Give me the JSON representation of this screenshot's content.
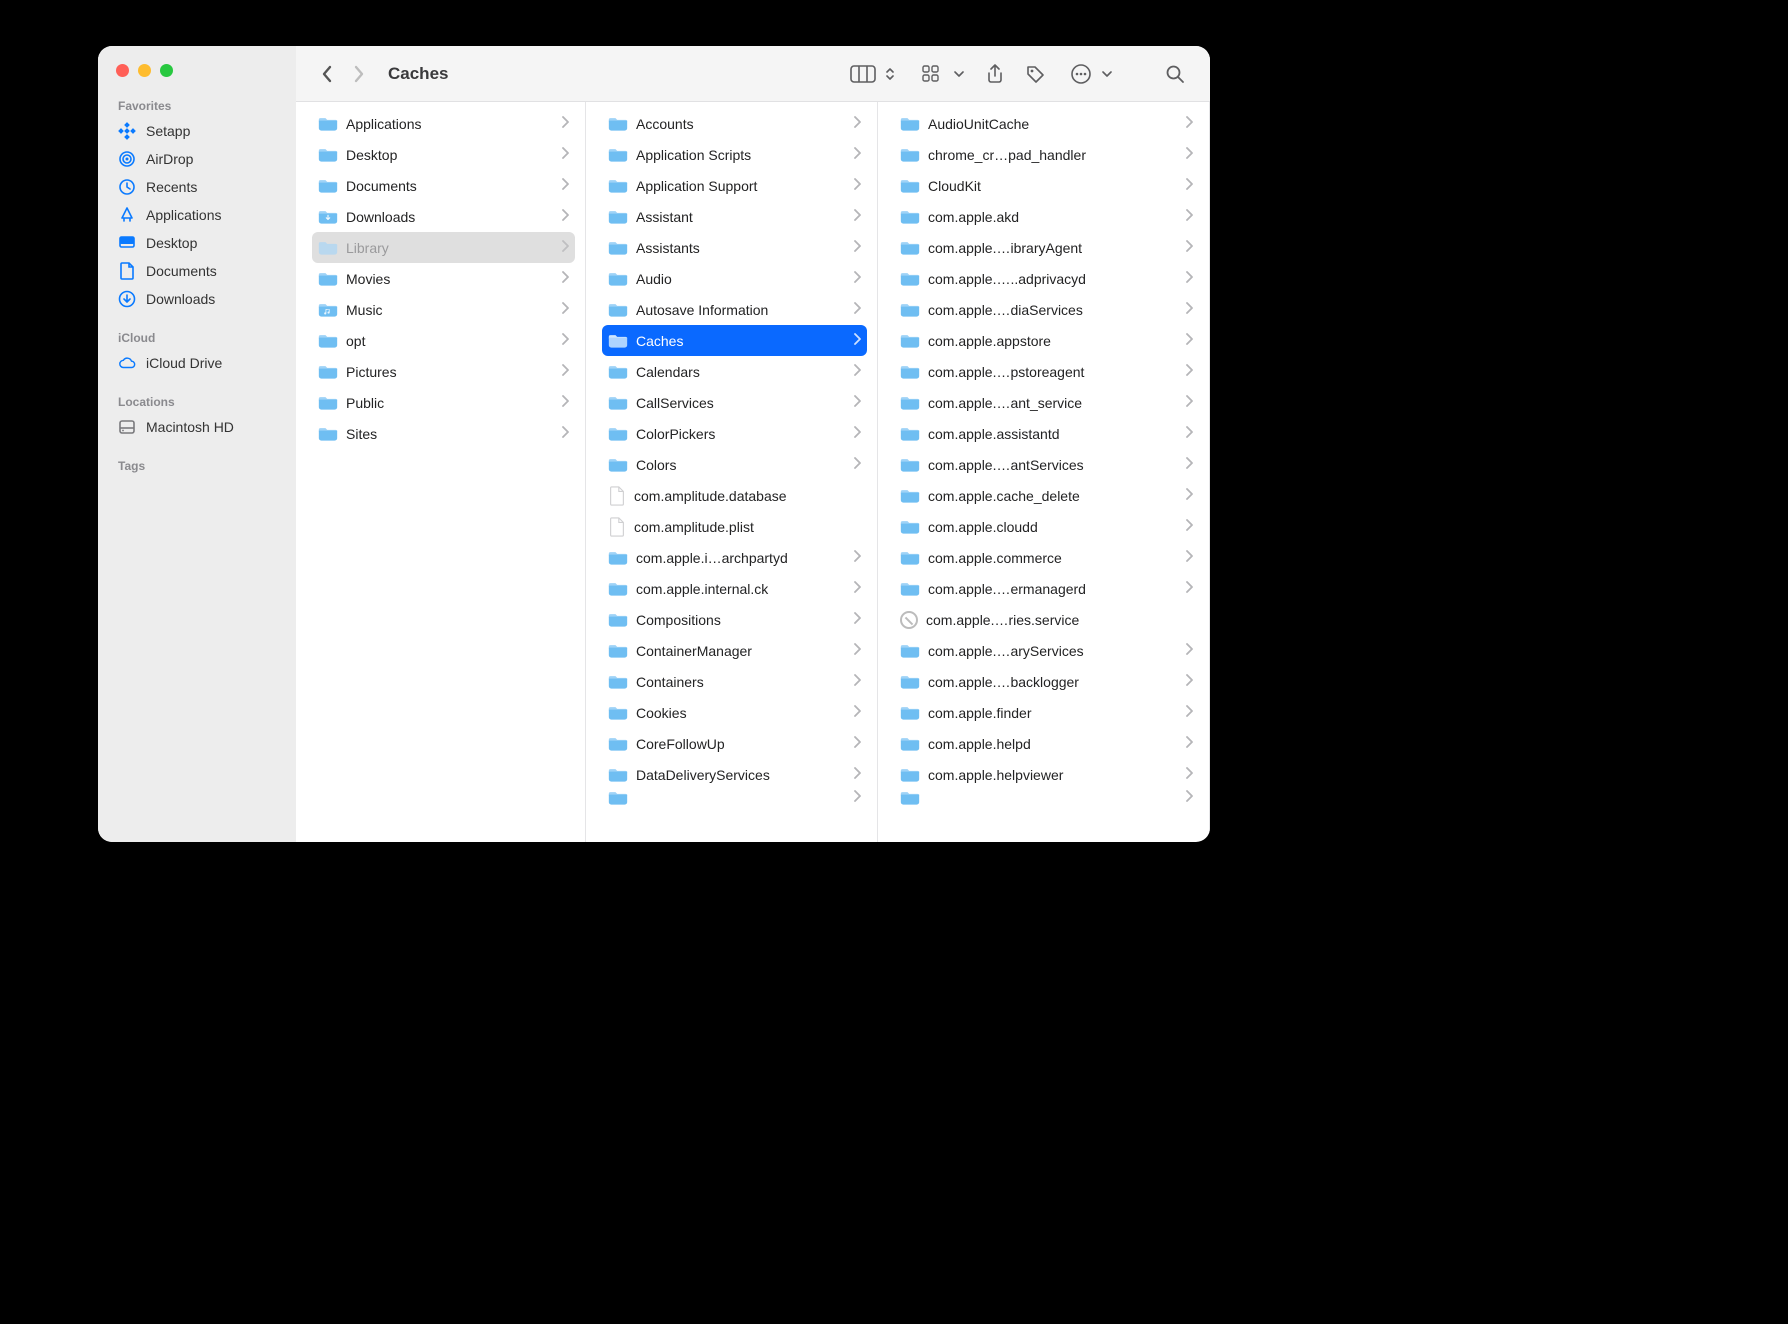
{
  "window_title": "Caches",
  "sidebar": {
    "sections": [
      {
        "title": "Favorites",
        "items": [
          {
            "icon": "setapp",
            "label": "Setapp"
          },
          {
            "icon": "airdrop",
            "label": "AirDrop"
          },
          {
            "icon": "recents",
            "label": "Recents"
          },
          {
            "icon": "applications",
            "label": "Applications"
          },
          {
            "icon": "desktop",
            "label": "Desktop"
          },
          {
            "icon": "documents",
            "label": "Documents"
          },
          {
            "icon": "downloads",
            "label": "Downloads"
          }
        ]
      },
      {
        "title": "iCloud",
        "items": [
          {
            "icon": "cloud",
            "label": "iCloud Drive"
          }
        ]
      },
      {
        "title": "Locations",
        "items": [
          {
            "icon": "disk",
            "label": "Macintosh HD"
          }
        ]
      },
      {
        "title": "Tags",
        "items": []
      }
    ]
  },
  "columns": [
    {
      "selected_index": 5,
      "selection_style": "dim",
      "items": [
        {
          "type": "folder",
          "name": "Applications",
          "hasChildren": true
        },
        {
          "type": "folder",
          "name": "Desktop",
          "hasChildren": true
        },
        {
          "type": "folder",
          "name": "Documents",
          "hasChildren": true
        },
        {
          "type": "folder",
          "name": "Downloads",
          "hasChildren": true
        },
        {
          "type": "folder",
          "name": "Library",
          "hasChildren": true
        },
        {
          "type": "folder",
          "name": "Movies",
          "hasChildren": true
        },
        {
          "type": "folder",
          "name": "Music",
          "hasChildren": true
        },
        {
          "type": "folder",
          "name": "opt",
          "hasChildren": true
        },
        {
          "type": "folder",
          "name": "Pictures",
          "hasChildren": true
        },
        {
          "type": "folder",
          "name": "Public",
          "hasChildren": true
        },
        {
          "type": "folder",
          "name": "Sites",
          "hasChildren": true
        }
      ]
    },
    {
      "selected_index": 7,
      "selection_style": "primary",
      "items": [
        {
          "type": "folder",
          "name": "Accounts",
          "hasChildren": true
        },
        {
          "type": "folder",
          "name": "Application Scripts",
          "hasChildren": true
        },
        {
          "type": "folder",
          "name": "Application Support",
          "hasChildren": true
        },
        {
          "type": "folder",
          "name": "Assistant",
          "hasChildren": true
        },
        {
          "type": "folder",
          "name": "Assistants",
          "hasChildren": true
        },
        {
          "type": "folder",
          "name": "Audio",
          "hasChildren": true
        },
        {
          "type": "folder",
          "name": "Autosave Information",
          "hasChildren": true
        },
        {
          "type": "folder",
          "name": "Caches",
          "hasChildren": true
        },
        {
          "type": "folder",
          "name": "Calendars",
          "hasChildren": true
        },
        {
          "type": "folder",
          "name": "CallServices",
          "hasChildren": true
        },
        {
          "type": "folder",
          "name": "ColorPickers",
          "hasChildren": true
        },
        {
          "type": "folder",
          "name": "Colors",
          "hasChildren": true
        },
        {
          "type": "file",
          "name": "com.amplitude.database",
          "hasChildren": false
        },
        {
          "type": "file",
          "name": "com.amplitude.plist",
          "hasChildren": false
        },
        {
          "type": "folder",
          "name": "com.apple.i…archpartyd",
          "hasChildren": true
        },
        {
          "type": "folder",
          "name": "com.apple.internal.ck",
          "hasChildren": true
        },
        {
          "type": "folder",
          "name": "Compositions",
          "hasChildren": true
        },
        {
          "type": "folder",
          "name": "ContainerManager",
          "hasChildren": true
        },
        {
          "type": "folder",
          "name": "Containers",
          "hasChildren": true
        },
        {
          "type": "folder",
          "name": "Cookies",
          "hasChildren": true
        },
        {
          "type": "folder",
          "name": "CoreFollowUp",
          "hasChildren": true
        },
        {
          "type": "folder",
          "name": "DataDeliveryServices",
          "hasChildren": true
        },
        {
          "type": "folder",
          "name": "",
          "hasChildren": true,
          "cutoff": true
        }
      ]
    },
    {
      "selected_index": -1,
      "selection_style": "none",
      "items": [
        {
          "type": "folder",
          "name": "AudioUnitCache",
          "hasChildren": true
        },
        {
          "type": "folder",
          "name": "chrome_cr…pad_handler",
          "hasChildren": true
        },
        {
          "type": "folder",
          "name": "CloudKit",
          "hasChildren": true
        },
        {
          "type": "folder",
          "name": "com.apple.akd",
          "hasChildren": true
        },
        {
          "type": "folder",
          "name": "com.apple.…ibraryAgent",
          "hasChildren": true
        },
        {
          "type": "folder",
          "name": "com.apple.…..adprivacyd",
          "hasChildren": true
        },
        {
          "type": "folder",
          "name": "com.apple.…diaServices",
          "hasChildren": true
        },
        {
          "type": "folder",
          "name": "com.apple.appstore",
          "hasChildren": true
        },
        {
          "type": "folder",
          "name": "com.apple.…pstoreagent",
          "hasChildren": true
        },
        {
          "type": "folder",
          "name": "com.apple.…ant_service",
          "hasChildren": true
        },
        {
          "type": "folder",
          "name": "com.apple.assistantd",
          "hasChildren": true
        },
        {
          "type": "folder",
          "name": "com.apple.…antServices",
          "hasChildren": true
        },
        {
          "type": "folder",
          "name": "com.apple.cache_delete",
          "hasChildren": true
        },
        {
          "type": "folder",
          "name": "com.apple.cloudd",
          "hasChildren": true
        },
        {
          "type": "folder",
          "name": "com.apple.commerce",
          "hasChildren": true
        },
        {
          "type": "folder",
          "name": "com.apple.…ermanagerd",
          "hasChildren": true
        },
        {
          "type": "blocked",
          "name": "com.apple.…ries.service",
          "hasChildren": false
        },
        {
          "type": "folder",
          "name": "com.apple.…aryServices",
          "hasChildren": true
        },
        {
          "type": "folder",
          "name": "com.apple.…backlogger",
          "hasChildren": true
        },
        {
          "type": "folder",
          "name": "com.apple.finder",
          "hasChildren": true
        },
        {
          "type": "folder",
          "name": "com.apple.helpd",
          "hasChildren": true
        },
        {
          "type": "folder",
          "name": "com.apple.helpviewer",
          "hasChildren": true
        },
        {
          "type": "folder",
          "name": "",
          "hasChildren": true,
          "cutoff": true
        }
      ]
    }
  ]
}
